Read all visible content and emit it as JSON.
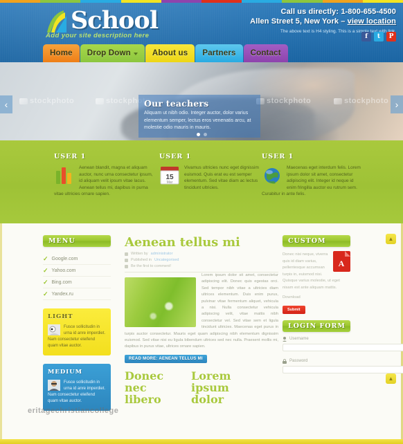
{
  "colors": {
    "header_blue": "#1c6fb4",
    "band_green": "#a9c93d",
    "accent_yellow": "#f3df1e",
    "accent_orange": "#f08a2a",
    "accent_blue": "#3b9fd6",
    "accent_purple": "#8e44ad",
    "accent_red": "#e0301b",
    "body_bg": "#fbfbf6"
  },
  "rainbow": [
    "#f0a21e",
    "#8cc63f",
    "#29abe2",
    "#f2e422",
    "#8e44ad",
    "#e0301b",
    "#29abe2",
    "#8cc63f",
    "#f0a21e",
    "#f2e422"
  ],
  "header": {
    "logo_name": "School",
    "logo_tagline": "Add your site description here",
    "phone_label": "Call us directly:",
    "phone_number": "1-800-655-4500",
    "address": "Allen Street 5, New York",
    "address_separator": "–",
    "address_link": "view location",
    "note_prefix": "The above text is H4 styling. This is a simple text with ",
    "note_link": "link",
    "note_suffix": ".",
    "socials": [
      {
        "name": "facebook-icon",
        "glyph": "f",
        "color": "#3b5998"
      },
      {
        "name": "twitter-icon",
        "glyph": "t",
        "color": "#29abe2"
      },
      {
        "name": "pinterest-icon",
        "glyph": "P",
        "color": "#e0301b"
      }
    ]
  },
  "nav": {
    "items": [
      {
        "label": "Home",
        "color_top": "#f7a33b",
        "color_bottom": "#ee7f18",
        "caret": false
      },
      {
        "label": "Drop Down",
        "color_top": "#a8d84a",
        "color_bottom": "#8cc63f",
        "caret": true
      },
      {
        "label": "About us",
        "color_top": "#f7e73c",
        "color_bottom": "#edd616",
        "caret": false
      },
      {
        "label": "Partners",
        "color_top": "#5ec8ee",
        "color_bottom": "#29abe2",
        "caret": false
      },
      {
        "label": "Contact",
        "color_top": "#a25ec4",
        "color_bottom": "#8e44ad",
        "caret": false
      }
    ]
  },
  "slider": {
    "caption_title": "Our teachers",
    "caption_text": "Aliquam ut nibh odio. Integer auctor, dolor varius elementum semper, lectus eros venenatis arcu, at molestie odio mauris in mauris.",
    "prev_glyph": "‹",
    "next_glyph": "›",
    "watermarks": [
      "stockphoto",
      "stockphoto",
      "stockphoto",
      "stockphoto"
    ],
    "dots": [
      true,
      false
    ]
  },
  "features": [
    {
      "title": "USER 1",
      "icon": "bar-chart-icon",
      "text": "Aenean blandit, magna et aliquam auctor, nunc urna consectetur ipsum, id aliquam velit ipsum vitae lacus. Aenean tellus mi, dapibus in purna vitae ultricies ornare sapien."
    },
    {
      "title": "USER 1",
      "icon": "calendar-icon",
      "calendar_day": "15",
      "calendar_month": "Mar",
      "text": "Vivamus ultricies nunc eget dignissim euismod. Quis erat eu est semper elementum. Sed vitae diam ac lectus tincidunt ultricies."
    },
    {
      "title": "USER 1",
      "icon": "globe-icon",
      "text": "Maecenas eget interdum felis. Lorem ipsum dolor sit amet, consectetur adipiscing elit. Integer id neque id enim fringilla auctor eu rutrum sem. Curabitur in ante felis."
    }
  ],
  "sidebar_left": {
    "menu_title": "MENU",
    "menu_items": [
      "Google.com",
      "Yahoo.com",
      "Bing.com",
      "Yandex.ru"
    ],
    "light_box": {
      "title": "LIGHT",
      "text": "Fusce sollicitudin in urna id anre imperdiet. Nam consectetur eleifend quam vitae auctor."
    },
    "medium_box": {
      "title": "MEDIUM",
      "text": "Fusce sollicitudin in urna id anre imperdiet. Nam consectetur eleifend quam vitae auctor."
    }
  },
  "post": {
    "title": "Aenean tellus mi",
    "meta": [
      {
        "icon": "user-icon",
        "text": "Written by ",
        "link": "administrator"
      },
      {
        "icon": "folder-icon",
        "text": "Published in ",
        "link": "Uncategorised"
      },
      {
        "icon": "comment-icon",
        "text": "Be the first to comment!",
        "link": ""
      }
    ],
    "image_alt": "green-leaf-dew-image",
    "body": "Lorem ipsum dolor sit amet, consectetur adipiscing elit. Donec quis egestas orci. Sed tempor nibh vitae a ultricies diam ultrices elementum. Duis enim purus, pulvinar vitae fermentum aliquet, vehicula a nisi. Nulla consectetur vehicula adipiscing velit, vitae mattis nibh consectetur vel. Sed vitae sem et ligula tincidunt ultricies. Maecenas eget purus in turpis auctor consectetur. Mauris eget quam adipiscing nibh elementum dignissim euismod. Sed vitae nisi eu ligula bibendum ultrices sed nec nulla. Praesent mollis mi, dapibus in purus vitae, ultrices ornare sapien.",
    "read_more": "READ MORE: AENEAN TELLUS MI",
    "sub_headings": [
      "Donec nec libero",
      "Lorem ipsum dolor"
    ]
  },
  "sidebar_right": {
    "custom_title": "CUSTOM",
    "custom_icon": "pdf-file-icon",
    "custom_text": "Donec nisi neque, viverra quis id diam varius, pellentesque accumsan turpis in, euismod nisi. Quisque varius molestie, ut eget nisam est ante aliquam mattis.",
    "download_label": "Download",
    "button_label": "Submit",
    "login_title": "LOGIN FORM",
    "username_label": "Username",
    "username_value": "",
    "password_label": "Password",
    "password_value": ""
  },
  "rail": {
    "top_glyph": "▲",
    "bottom_glyph": "▲"
  },
  "watermark": "eritagechristiancollege"
}
